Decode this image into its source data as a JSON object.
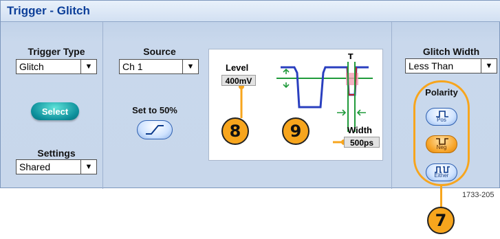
{
  "title": "Trigger - Glitch",
  "trigger_type": {
    "label": "Trigger Type",
    "value": "Glitch"
  },
  "select_button": "Select",
  "settings": {
    "label": "Settings",
    "value": "Shared"
  },
  "source": {
    "label": "Source",
    "value": "Ch 1"
  },
  "set50": {
    "label": "Set to 50%"
  },
  "diagram": {
    "level_label": "Level",
    "level_value": "400mV",
    "width_label": "Width",
    "width_value": "500ps",
    "trigger_marker": "T"
  },
  "glitch_width": {
    "label": "Glitch Width",
    "value": "Less Than"
  },
  "polarity": {
    "label": "Polarity",
    "buttons": [
      {
        "label": "Pos",
        "selected": false
      },
      {
        "label": "Neg",
        "selected": true
      },
      {
        "label": "Either",
        "selected": false
      }
    ]
  },
  "callouts": [
    "8",
    "9",
    "7"
  ],
  "figure_id": "1733-205",
  "colors": {
    "accent": "#f7a51d",
    "title": "#0d3f99",
    "waveform": "#2a3fbf",
    "level_line": "#1f9a3a"
  }
}
